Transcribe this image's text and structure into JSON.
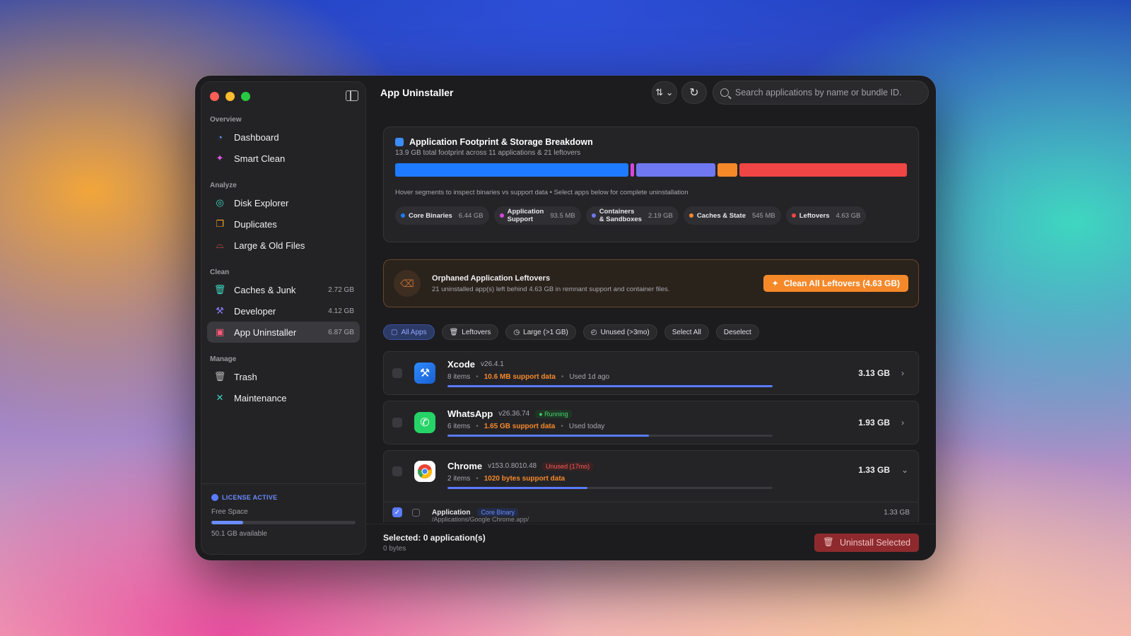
{
  "window": {
    "title": "App Uninstaller"
  },
  "sidebar": {
    "sections": [
      {
        "title": "Overview"
      },
      {
        "title": "Analyze"
      },
      {
        "title": "Clean"
      },
      {
        "title": "Manage"
      }
    ],
    "items": [
      {
        "label": "Dashboard",
        "icon": "dashboard-icon",
        "badge": ""
      },
      {
        "label": "Smart Clean",
        "icon": "sparkle-icon",
        "badge": ""
      },
      {
        "label": "Disk Explorer",
        "icon": "disk-icon",
        "badge": ""
      },
      {
        "label": "Duplicates",
        "icon": "duplicates-icon",
        "badge": ""
      },
      {
        "label": "Large & Old Files",
        "icon": "drive-icon",
        "badge": ""
      },
      {
        "label": "Caches & Junk",
        "icon": "trash-icon",
        "badge": "2.72 GB"
      },
      {
        "label": "Developer",
        "icon": "hammer-icon",
        "badge": "4.12 GB"
      },
      {
        "label": "App Uninstaller",
        "icon": "app-remove-icon",
        "badge": "6.87 GB"
      },
      {
        "label": "Trash",
        "icon": "trash-icon",
        "badge": ""
      },
      {
        "label": "Maintenance",
        "icon": "wrench-icon",
        "badge": ""
      }
    ],
    "footer": {
      "license": "LICENSE ACTIVE",
      "free_space_label": "Free Space",
      "free_space_fraction": 0.22,
      "available": "50.1 GB available"
    }
  },
  "toolbar": {
    "sort_label": "⇅ ⌄",
    "refresh_label": "↻",
    "search_placeholder": "Search applications by name or bundle ID."
  },
  "footprint": {
    "title": "Application Footprint & Storage Breakdown",
    "subtitle": "13.9 GB total footprint across 11 applications & 21 leftovers",
    "hint": "Hover segments to inspect binaries vs support data • Select apps below for complete uninstallation",
    "segments": [
      {
        "name": "Core Binaries",
        "value_gb": 6.44,
        "display": "6.44 GB",
        "color": "#1e7bff"
      },
      {
        "name": "Application Support",
        "value_gb": 0.0935,
        "display": "93.5 MB",
        "color": "#d846e0"
      },
      {
        "name": "Containers & Sandboxes",
        "value_gb": 2.19,
        "display": "2.19 GB",
        "color": "#6f78f0"
      },
      {
        "name": "Caches & State",
        "value_gb": 0.545,
        "display": "545 MB",
        "color": "#f5892a"
      },
      {
        "name": "Leftovers",
        "value_gb": 4.63,
        "display": "4.63 GB",
        "color": "#f04545"
      }
    ],
    "legend_names": [
      "Core Binaries",
      "Application\nSupport",
      "Containers\n& Sandboxes",
      "Caches & State",
      "Leftovers"
    ]
  },
  "orphan": {
    "title": "Orphaned Application Leftovers",
    "subtitle": "21 uninstalled app(s) left behind 4.63 GB in remnant support and container files.",
    "button": "Clean All Leftovers (4.63 GB)"
  },
  "filters": {
    "all_apps": "All Apps",
    "leftovers": "Leftovers",
    "large": "Large (>1 GB)",
    "unused": "Unused (>3mo)",
    "select_all": "Select All",
    "deselect": "Deselect"
  },
  "apps": [
    {
      "name": "Xcode",
      "version": "v26.4.1",
      "tag": "",
      "items": "8 items",
      "support": "10.6 MB support data",
      "used": "Used 1d ago",
      "size": "3.13 GB",
      "bar": 1.0,
      "chevron": "›"
    },
    {
      "name": "WhatsApp",
      "version": "v26.36.74",
      "tag": "● Running",
      "items": "6 items",
      "support": "1.65 GB support data",
      "used": "Used today",
      "size": "1.93 GB",
      "bar": 0.62,
      "chevron": "›"
    },
    {
      "name": "Chrome",
      "version": "v153.0.8010.48",
      "tag": "Unused (17mo)",
      "items": "2 items",
      "support": "1020 bytes support data",
      "used": "",
      "size": "1.33 GB",
      "bar": 0.43,
      "chevron": "⌄"
    }
  ],
  "chrome_sub": {
    "label": "Application",
    "tag": "Core Binary",
    "path": "/Applications/Google Chrome.app/",
    "size": "1.33 GB"
  },
  "bottom": {
    "selected": "Selected: 0 application(s)",
    "bytes": "0 bytes",
    "uninstall": "Uninstall Selected"
  }
}
